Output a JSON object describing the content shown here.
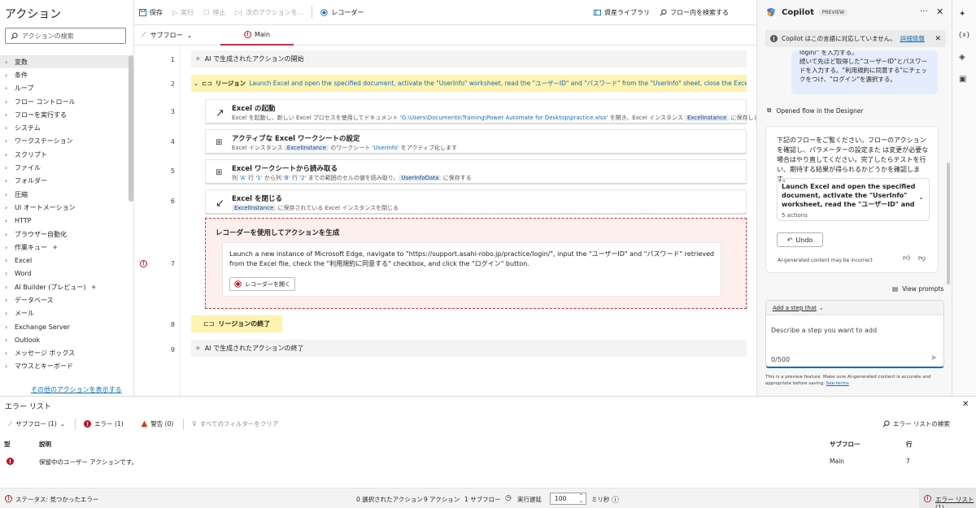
{
  "left": {
    "title": "アクション",
    "search_placeholder": "アクションの検索",
    "categories": [
      "変数",
      "条件",
      "ループ",
      "フロー コントロール",
      "フローを実行する",
      "システム",
      "ワークステーション",
      "スクリプト",
      "ファイル",
      "フォルダー",
      "圧縮",
      "UI オートメーション",
      "HTTP",
      "ブラウザー自動化",
      "作業キュー",
      "Excel",
      "Word",
      "AI Builder (プレビュー)",
      "データベース",
      "メール",
      "Exchange Server",
      "Outlook",
      "メッセージ ボックス",
      "マウスとキーボード"
    ],
    "more_link": "その他のアクションを表示する"
  },
  "toolbar": {
    "save": "保存",
    "run": "実行",
    "stop": "停止",
    "next": "次のアクションを...",
    "recorder": "レコーダー",
    "asset_library": "資産ライブラリ",
    "search_flow": "フロー内を検索する"
  },
  "tabs": {
    "subflow": "サブフロー",
    "main": "Main"
  },
  "canvas": {
    "line_numbers": [
      "1",
      "2",
      "3",
      "4",
      "5",
      "6",
      "7",
      "8",
      "9"
    ],
    "ai_start": "AI で生成されたアクションの開始",
    "region_label": "リージョン",
    "region_desc": "Launch Excel and open the specified document, activate the \"UserInfo\" worksheet, read the \"ユーザーID\" and \"パスワード\" from the \"UserInfo\" sheet, close the Excel instance",
    "actions": [
      {
        "title": "Excel の起動",
        "desc_a": "Excel を起動し、新しい Excel プロセスを使用してドキュメント ",
        "desc_b": "'G:\\Users\\Documents\\Training\\Power Automate for Desktop\\practice.xlsx'",
        "desc_c": " を開き、Excel インスタンス ",
        "pill": "ExcelInstance",
        "desc_d": " に保存します。"
      },
      {
        "title": "アクティブな Excel ワークシートの設定",
        "desc_a": "Excel インスタンス ",
        "pill": "ExcelInstance",
        "desc_c": " のワークシート ",
        "desc_b": "'UserInfo'",
        "desc_d": " をアクティブ化します"
      },
      {
        "title": "Excel ワークシートから読み取る",
        "desc_a": "列 ",
        "desc_b": "'A'",
        "desc_c": " 行 ",
        "desc_e": "'1'",
        "desc_f": " から列 ",
        "desc_g": "'B'",
        "desc_h": " 行 ",
        "desc_i": "'2'",
        "desc_j": " までの範囲のセルの値を読み取り、",
        "pill": "UserInfoData",
        "desc_d": " に保存する"
      },
      {
        "title": "Excel を閉じる",
        "pill": "ExcelInstance",
        "desc_d": " に保存されている Excel インスタンスを閉じる"
      }
    ],
    "recorder_title": "レコーダーを使用してアクションを生成",
    "recorder_desc": "Launch a new instance of Microsoft Edge, navigate to \"https://support.asahi-robo.jp/practice/login/\", input the \"ユーザーID\" and \"パスワード\" retrieved from the Excel file, check the \"利用規約に同意する\" checkbox, and click the \"ログイン\" button.",
    "recorder_button": "レコーダーを開く",
    "region_end": "リージョンの終了",
    "ai_end": "AI で生成されたアクションの終了"
  },
  "copilot": {
    "title": "Copilot",
    "badge": "PREVIEW",
    "warning": "Copilot はこの言語に対応していません。",
    "warning_link": "詳細情報",
    "user_msg_l1": "login/\" を入力する。",
    "user_msg_l2": "続いて先ほど取得した\"ユーザーID\"とパスワードを入力する。\"利用規約に同意する\"にチェックをつけ、\"ログイン\"を選択する。",
    "opened": "Opened flow in the Designer",
    "reply": "下記のフローをご覧ください。フローのアクションを確認し、パラメーターの設定また は変更が必要な場合はやり直してください。完了したらテストを行い、期待する結果が得られるかどうかを確認します。",
    "flow_title": "Launch Excel and open the specified document, activate the \"UserInfo\" worksheet, read the \"ユーザーID\" and \"...",
    "flow_sub": "5 actions",
    "undo": "Undo",
    "disclaimer": "AI-generated content may be incorrect",
    "view_prompts": "View prompts",
    "add_step": "Add a step that",
    "input_placeholder": "Describe a step you want to add",
    "counter": "0/500",
    "footer": "This is a preview feature. Make sure AI-generated content is accurate and appropriate before saving.",
    "footer_link": "See terms"
  },
  "errors": {
    "title": "エラー リスト",
    "subflow_filter": "サブフロー (1)",
    "errors_count": "エラー (1)",
    "warnings_count": "警告 (0)",
    "clear_filters": "すべてのフィルターをクリア",
    "search": "エラー リストの検索",
    "headers": {
      "type": "型",
      "desc": "説明",
      "subflow": "サブフロー",
      "line": "行"
    },
    "rows": [
      {
        "desc": "保留中のユーザー アクションです。",
        "subflow": "Main",
        "line": "7"
      }
    ]
  },
  "status": {
    "state": "ステータス: 見つかったエラー",
    "selected": "0 選択されたアクション",
    "actions": "9 アクション",
    "subflows": "1 サブフロー",
    "delay_label": "実行遅延",
    "delay_value": "100",
    "unit": "ミリ秒",
    "error_list": "エラー リスト (1)"
  },
  "colors": {
    "accent": "#0f6cbd",
    "region": "#fff3b0",
    "error": "#c50f1f",
    "recorder_border": "#d13438"
  }
}
